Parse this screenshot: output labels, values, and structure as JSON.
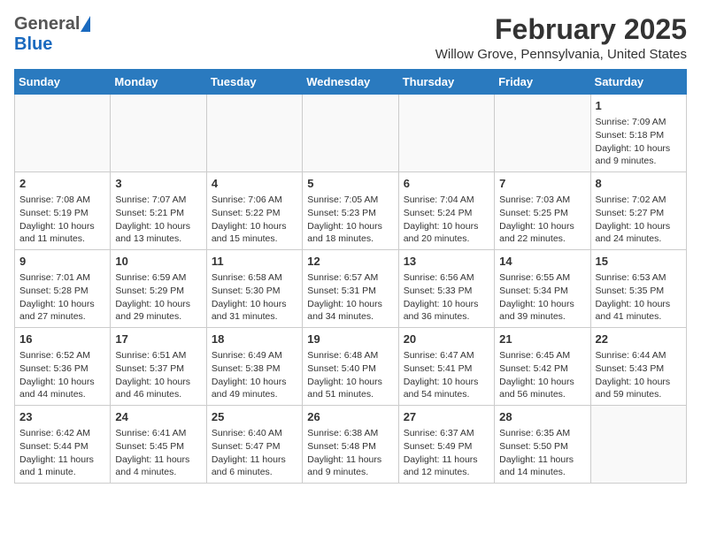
{
  "header": {
    "logo_general": "General",
    "logo_blue": "Blue",
    "month_title": "February 2025",
    "location": "Willow Grove, Pennsylvania, United States"
  },
  "weekdays": [
    "Sunday",
    "Monday",
    "Tuesday",
    "Wednesday",
    "Thursday",
    "Friday",
    "Saturday"
  ],
  "weeks": [
    [
      {
        "day": "",
        "info": ""
      },
      {
        "day": "",
        "info": ""
      },
      {
        "day": "",
        "info": ""
      },
      {
        "day": "",
        "info": ""
      },
      {
        "day": "",
        "info": ""
      },
      {
        "day": "",
        "info": ""
      },
      {
        "day": "1",
        "info": "Sunrise: 7:09 AM\nSunset: 5:18 PM\nDaylight: 10 hours and 9 minutes."
      }
    ],
    [
      {
        "day": "2",
        "info": "Sunrise: 7:08 AM\nSunset: 5:19 PM\nDaylight: 10 hours and 11 minutes."
      },
      {
        "day": "3",
        "info": "Sunrise: 7:07 AM\nSunset: 5:21 PM\nDaylight: 10 hours and 13 minutes."
      },
      {
        "day": "4",
        "info": "Sunrise: 7:06 AM\nSunset: 5:22 PM\nDaylight: 10 hours and 15 minutes."
      },
      {
        "day": "5",
        "info": "Sunrise: 7:05 AM\nSunset: 5:23 PM\nDaylight: 10 hours and 18 minutes."
      },
      {
        "day": "6",
        "info": "Sunrise: 7:04 AM\nSunset: 5:24 PM\nDaylight: 10 hours and 20 minutes."
      },
      {
        "day": "7",
        "info": "Sunrise: 7:03 AM\nSunset: 5:25 PM\nDaylight: 10 hours and 22 minutes."
      },
      {
        "day": "8",
        "info": "Sunrise: 7:02 AM\nSunset: 5:27 PM\nDaylight: 10 hours and 24 minutes."
      }
    ],
    [
      {
        "day": "9",
        "info": "Sunrise: 7:01 AM\nSunset: 5:28 PM\nDaylight: 10 hours and 27 minutes."
      },
      {
        "day": "10",
        "info": "Sunrise: 6:59 AM\nSunset: 5:29 PM\nDaylight: 10 hours and 29 minutes."
      },
      {
        "day": "11",
        "info": "Sunrise: 6:58 AM\nSunset: 5:30 PM\nDaylight: 10 hours and 31 minutes."
      },
      {
        "day": "12",
        "info": "Sunrise: 6:57 AM\nSunset: 5:31 PM\nDaylight: 10 hours and 34 minutes."
      },
      {
        "day": "13",
        "info": "Sunrise: 6:56 AM\nSunset: 5:33 PM\nDaylight: 10 hours and 36 minutes."
      },
      {
        "day": "14",
        "info": "Sunrise: 6:55 AM\nSunset: 5:34 PM\nDaylight: 10 hours and 39 minutes."
      },
      {
        "day": "15",
        "info": "Sunrise: 6:53 AM\nSunset: 5:35 PM\nDaylight: 10 hours and 41 minutes."
      }
    ],
    [
      {
        "day": "16",
        "info": "Sunrise: 6:52 AM\nSunset: 5:36 PM\nDaylight: 10 hours and 44 minutes."
      },
      {
        "day": "17",
        "info": "Sunrise: 6:51 AM\nSunset: 5:37 PM\nDaylight: 10 hours and 46 minutes."
      },
      {
        "day": "18",
        "info": "Sunrise: 6:49 AM\nSunset: 5:38 PM\nDaylight: 10 hours and 49 minutes."
      },
      {
        "day": "19",
        "info": "Sunrise: 6:48 AM\nSunset: 5:40 PM\nDaylight: 10 hours and 51 minutes."
      },
      {
        "day": "20",
        "info": "Sunrise: 6:47 AM\nSunset: 5:41 PM\nDaylight: 10 hours and 54 minutes."
      },
      {
        "day": "21",
        "info": "Sunrise: 6:45 AM\nSunset: 5:42 PM\nDaylight: 10 hours and 56 minutes."
      },
      {
        "day": "22",
        "info": "Sunrise: 6:44 AM\nSunset: 5:43 PM\nDaylight: 10 hours and 59 minutes."
      }
    ],
    [
      {
        "day": "23",
        "info": "Sunrise: 6:42 AM\nSunset: 5:44 PM\nDaylight: 11 hours and 1 minute."
      },
      {
        "day": "24",
        "info": "Sunrise: 6:41 AM\nSunset: 5:45 PM\nDaylight: 11 hours and 4 minutes."
      },
      {
        "day": "25",
        "info": "Sunrise: 6:40 AM\nSunset: 5:47 PM\nDaylight: 11 hours and 6 minutes."
      },
      {
        "day": "26",
        "info": "Sunrise: 6:38 AM\nSunset: 5:48 PM\nDaylight: 11 hours and 9 minutes."
      },
      {
        "day": "27",
        "info": "Sunrise: 6:37 AM\nSunset: 5:49 PM\nDaylight: 11 hours and 12 minutes."
      },
      {
        "day": "28",
        "info": "Sunrise: 6:35 AM\nSunset: 5:50 PM\nDaylight: 11 hours and 14 minutes."
      },
      {
        "day": "",
        "info": ""
      }
    ]
  ]
}
